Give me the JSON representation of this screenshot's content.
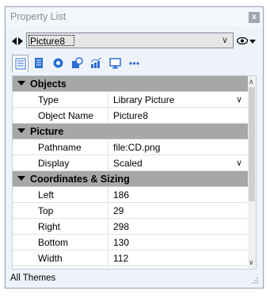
{
  "panel": {
    "title": "Property List",
    "close_glyph": "x"
  },
  "object_selector": {
    "value": "Picture8",
    "chevron": "∨"
  },
  "tabs": [
    {
      "name": "properties-tab-icon",
      "active": true
    },
    {
      "name": "document-tab-icon",
      "active": false
    },
    {
      "name": "settings-tab-icon",
      "active": false
    },
    {
      "name": "shapes-tab-icon",
      "active": false
    },
    {
      "name": "chart-tab-icon",
      "active": false
    },
    {
      "name": "monitor-tab-icon",
      "active": false
    },
    {
      "name": "more-tab-icon",
      "active": false
    }
  ],
  "grid": {
    "sections": [
      {
        "title": "Objects",
        "props": [
          {
            "name": "Type",
            "value": "Library Picture",
            "dropdown": true
          },
          {
            "name": "Object Name",
            "value": "Picture8",
            "dropdown": false
          }
        ]
      },
      {
        "title": "Picture",
        "props": [
          {
            "name": "Pathname",
            "value": "file:CD.png",
            "dropdown": false
          },
          {
            "name": "Display",
            "value": "Scaled",
            "dropdown": true
          }
        ]
      },
      {
        "title": "Coordinates & Sizing",
        "props": [
          {
            "name": "Left",
            "value": "186",
            "dropdown": false
          },
          {
            "name": "Top",
            "value": "29",
            "dropdown": false
          },
          {
            "name": "Right",
            "value": "298",
            "dropdown": false
          },
          {
            "name": "Bottom",
            "value": "130",
            "dropdown": false
          },
          {
            "name": "Width",
            "value": "112",
            "dropdown": false
          }
        ]
      }
    ]
  },
  "footer": {
    "text": "All Themes"
  },
  "colors": {
    "section_bg": "#a7a7a7",
    "panel_bg": "#eef3fa",
    "accent_blue": "#2a6fd6"
  }
}
